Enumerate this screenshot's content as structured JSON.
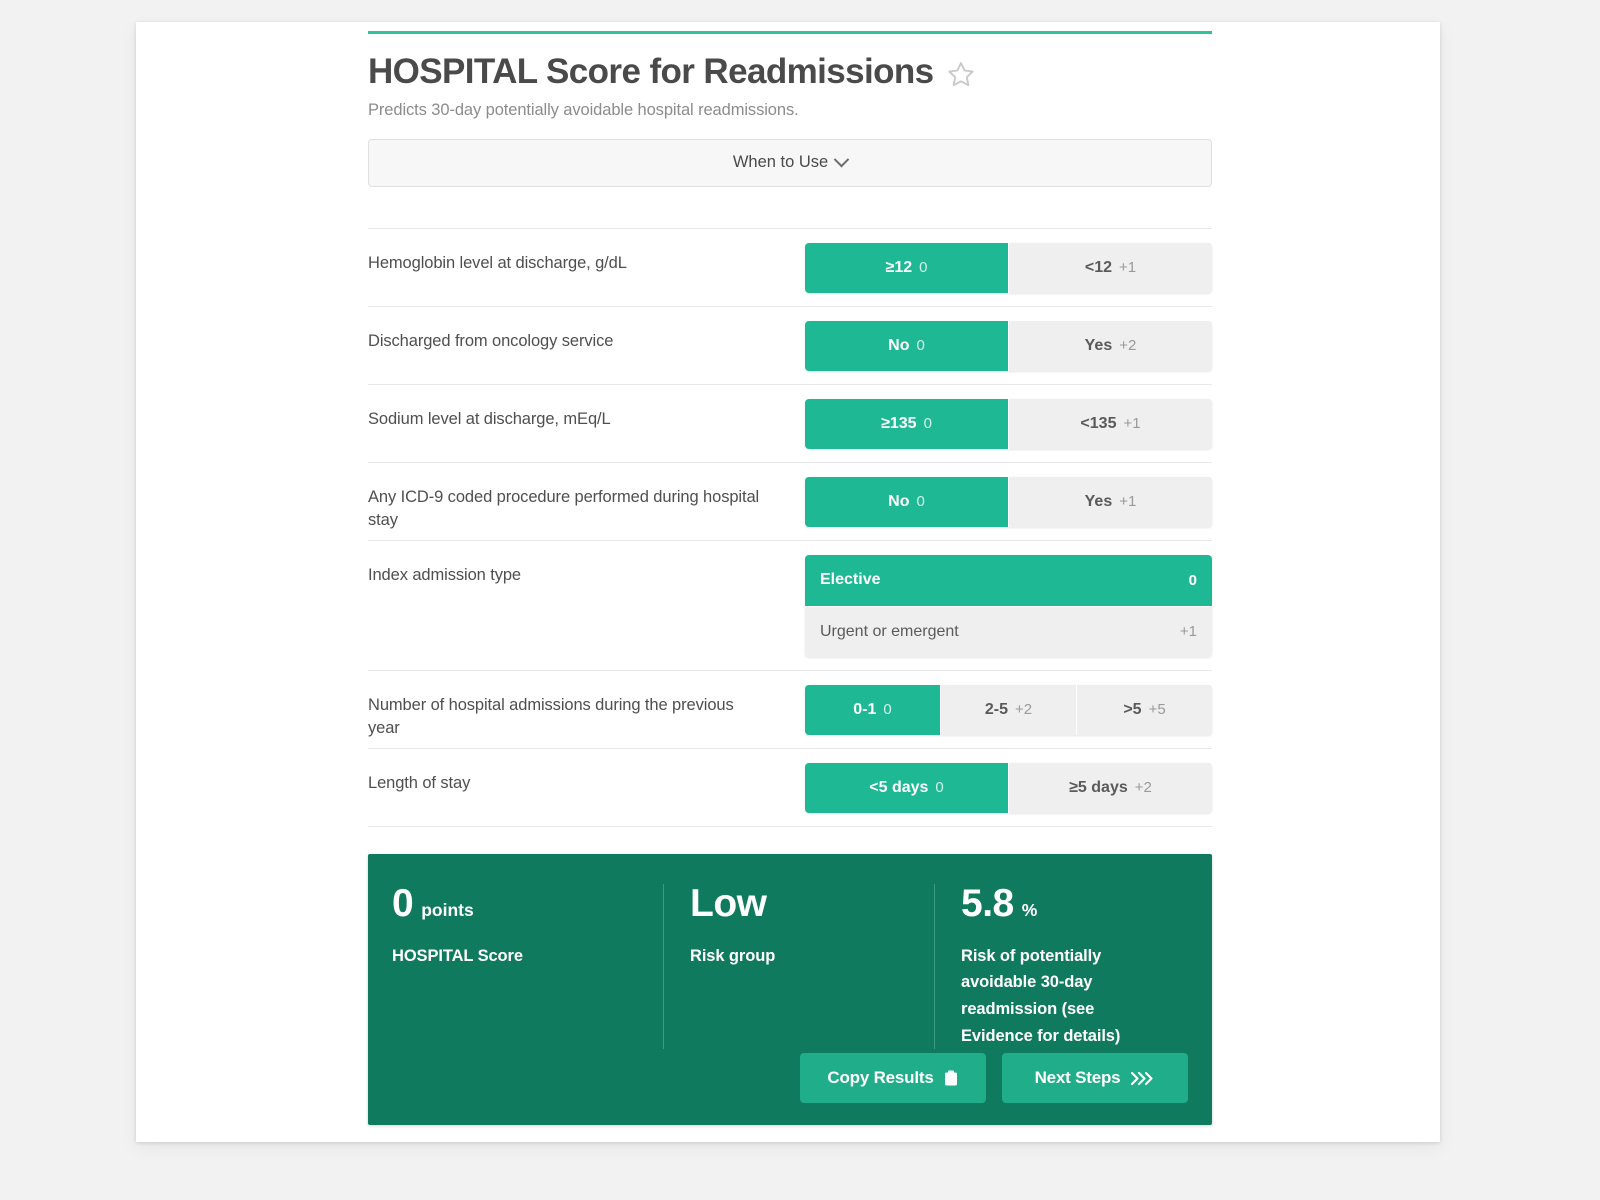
{
  "header": {
    "title": "HOSPITAL Score for Readmissions",
    "subtitle": "Predicts 30-day potentially avoidable hospital readmissions.",
    "favorite_icon": "star-outline-icon",
    "accent_color": "#2ec49a"
  },
  "when_to_use": {
    "label": "When to Use",
    "chevron_icon": "chevron-down-icon"
  },
  "questions": [
    {
      "label": "Hemoglobin level at discharge, g/dL",
      "layout": "horizontal",
      "options": [
        {
          "label": "≥12",
          "points": "0",
          "selected": true
        },
        {
          "label": "<12",
          "points": "+1",
          "selected": false
        }
      ]
    },
    {
      "label": "Discharged from oncology service",
      "layout": "horizontal",
      "options": [
        {
          "label": "No",
          "points": "0",
          "selected": true
        },
        {
          "label": "Yes",
          "points": "+2",
          "selected": false
        }
      ]
    },
    {
      "label": "Sodium level at discharge, mEq/L",
      "layout": "horizontal",
      "options": [
        {
          "label": "≥135",
          "points": "0",
          "selected": true
        },
        {
          "label": "<135",
          "points": "+1",
          "selected": false
        }
      ]
    },
    {
      "label": "Any ICD-9 coded procedure performed during hospital stay",
      "layout": "horizontal",
      "options": [
        {
          "label": "No",
          "points": "0",
          "selected": true
        },
        {
          "label": "Yes",
          "points": "+1",
          "selected": false
        }
      ]
    },
    {
      "label": "Index admission type",
      "layout": "vertical",
      "options": [
        {
          "label": "Elective",
          "points": "0",
          "selected": true
        },
        {
          "label": "Urgent or emergent",
          "points": "+1",
          "selected": false
        }
      ]
    },
    {
      "label": "Number of hospital admissions during the previous year",
      "layout": "horizontal",
      "options": [
        {
          "label": "0-1",
          "points": "0",
          "selected": true
        },
        {
          "label": "2-5",
          "points": "+2",
          "selected": false
        },
        {
          "label": ">5",
          "points": "+5",
          "selected": false
        }
      ]
    },
    {
      "label": "Length of stay",
      "layout": "horizontal",
      "options": [
        {
          "label": "<5 days",
          "points": "0",
          "selected": true
        },
        {
          "label": "≥5 days",
          "points": "+2",
          "selected": false
        }
      ]
    }
  ],
  "results": {
    "background_color": "#0f7a5e",
    "columns": [
      {
        "value": "0",
        "unit": "points",
        "description": "HOSPITAL Score"
      },
      {
        "value": "Low",
        "unit": "",
        "description": "Risk group"
      },
      {
        "value": "5.8",
        "unit": "%",
        "description": "Risk of potentially avoidable 30-day readmission (see Evidence for details)"
      }
    ],
    "buttons": [
      {
        "label": "Copy Results",
        "icon": "clipboard-icon"
      },
      {
        "label": "Next Steps",
        "icon": "double-chevron-right-icon"
      }
    ]
  }
}
